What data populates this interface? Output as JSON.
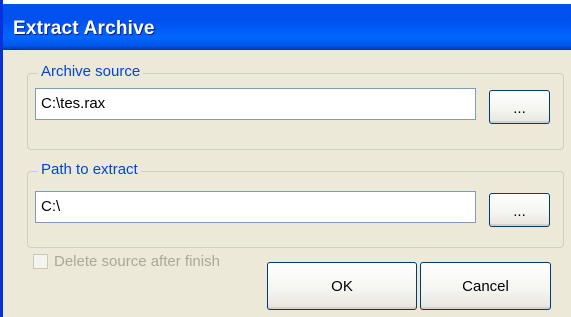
{
  "window": {
    "title": "Extract Archive"
  },
  "source_group": {
    "label": "Archive source",
    "value": "C:\\tes.rax",
    "browse_label": "..."
  },
  "extract_group": {
    "label": "Path to extract",
    "value": "C:\\",
    "browse_label": "..."
  },
  "options": {
    "delete_source_label": "Delete source after finish",
    "delete_source_checked": false,
    "delete_source_enabled": false
  },
  "buttons": {
    "ok_label": "OK",
    "cancel_label": "Cancel"
  },
  "colors": {
    "title_bar": "#0054E3",
    "dialog_bg": "#ECE9D8",
    "group_label": "#0046D5",
    "disabled_text": "#ACA899"
  }
}
